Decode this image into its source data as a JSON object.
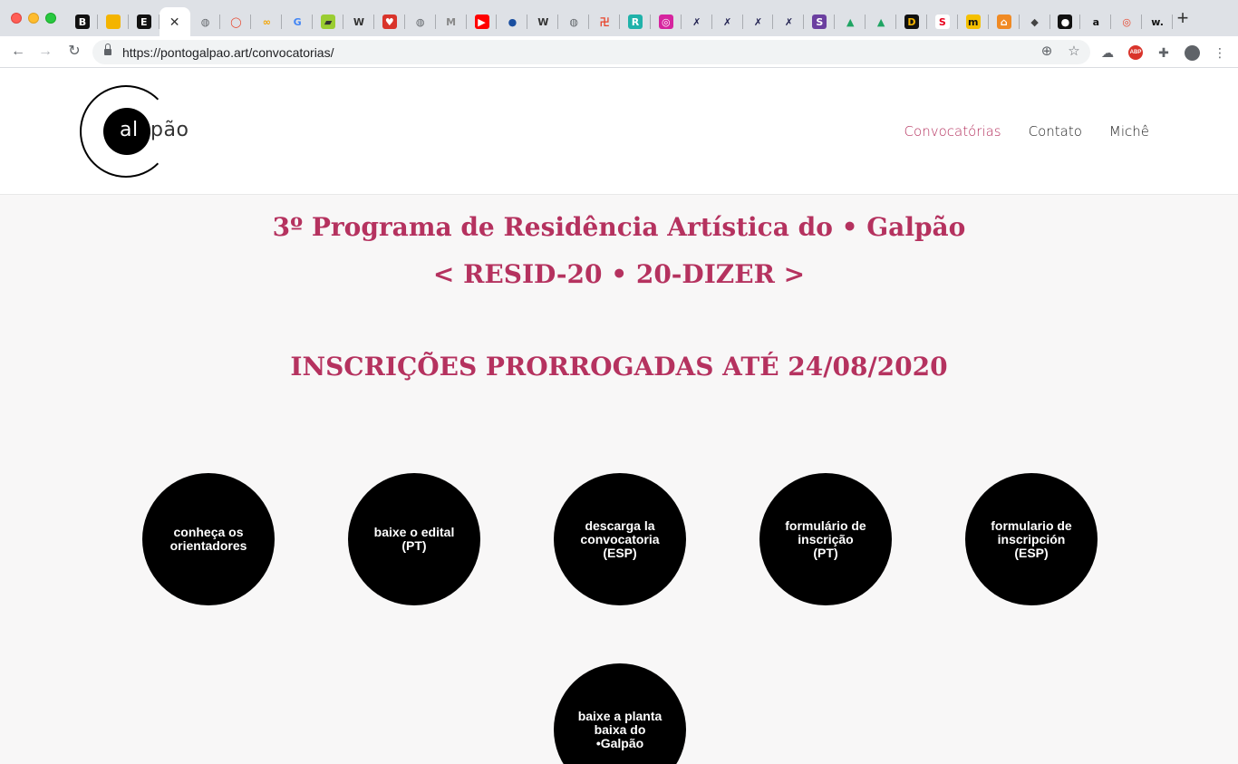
{
  "browser": {
    "tabs": [
      {
        "icon": "B",
        "bg": "#111111",
        "fg": "#ffffff"
      },
      {
        "icon": "",
        "bg": "#f4b400",
        "fg": "#ffffff"
      },
      {
        "icon": "E",
        "bg": "#111111",
        "fg": "#ffffff"
      },
      {
        "icon": "✕",
        "bg": "transparent",
        "fg": "#333333",
        "active": true
      },
      {
        "icon": "◍",
        "bg": "transparent",
        "fg": "#5f6368"
      },
      {
        "icon": "◯",
        "bg": "transparent",
        "fg": "#e8432a"
      },
      {
        "icon": "∞",
        "bg": "transparent",
        "fg": "#f4a400"
      },
      {
        "icon": "G",
        "bg": "transparent",
        "fg": "#4285f4"
      },
      {
        "icon": "▰",
        "bg": "#9acd32",
        "fg": "#333333"
      },
      {
        "icon": "W",
        "bg": "transparent",
        "fg": "#333333"
      },
      {
        "icon": "♥",
        "bg": "#d9342b",
        "fg": "#ffffff"
      },
      {
        "icon": "◍",
        "bg": "transparent",
        "fg": "#5f6368"
      },
      {
        "icon": "M",
        "bg": "transparent",
        "fg": "#888888"
      },
      {
        "icon": "▶",
        "bg": "#ff0000",
        "fg": "#ffffff"
      },
      {
        "icon": "●",
        "bg": "transparent",
        "fg": "#1a4fa0"
      },
      {
        "icon": "W",
        "bg": "transparent",
        "fg": "#333333"
      },
      {
        "icon": "◍",
        "bg": "transparent",
        "fg": "#5f6368"
      },
      {
        "icon": "卍",
        "bg": "transparent",
        "fg": "#e8432a"
      },
      {
        "icon": "R",
        "bg": "#20b2aa",
        "fg": "#ffffff"
      },
      {
        "icon": "◎",
        "bg": "#d6249f",
        "fg": "#ffffff"
      },
      {
        "icon": "✗",
        "bg": "transparent",
        "fg": "#1f1f4f"
      },
      {
        "icon": "✗",
        "bg": "transparent",
        "fg": "#1f1f4f"
      },
      {
        "icon": "✗",
        "bg": "transparent",
        "fg": "#1f1f4f"
      },
      {
        "icon": "✗",
        "bg": "transparent",
        "fg": "#1f1f4f"
      },
      {
        "icon": "S",
        "bg": "#6b3fa0",
        "fg": "#ffffff"
      },
      {
        "icon": "▲",
        "bg": "transparent",
        "fg": "#1fa463"
      },
      {
        "icon": "▲",
        "bg": "transparent",
        "fg": "#1fa463"
      },
      {
        "icon": "D",
        "bg": "#111111",
        "fg": "#f4b400"
      },
      {
        "icon": "S",
        "bg": "#ffffff",
        "fg": "#e8001c"
      },
      {
        "icon": "m",
        "bg": "#f5c000",
        "fg": "#111111"
      },
      {
        "icon": "⌂",
        "bg": "#f08a24",
        "fg": "#ffffff"
      },
      {
        "icon": "◆",
        "bg": "transparent",
        "fg": "#444444"
      },
      {
        "icon": "●",
        "bg": "#111111",
        "fg": "#ffffff"
      },
      {
        "icon": "a",
        "bg": "transparent",
        "fg": "#111111"
      },
      {
        "icon": "◎",
        "bg": "transparent",
        "fg": "#e8432a"
      },
      {
        "icon": "w.",
        "bg": "transparent",
        "fg": "#111111"
      }
    ],
    "url": "https://pontogalpao.art/convocatorias/"
  },
  "site": {
    "logo_text_inner": "al",
    "logo_text_outer": "pão",
    "nav": [
      {
        "label": "Convocatórias",
        "current": true
      },
      {
        "label": "Contato",
        "current": false
      },
      {
        "label": "Michê",
        "current": false
      }
    ]
  },
  "main": {
    "title_line1": "3º Programa de Residência Artística do • Galpão",
    "title_line2": "< RESID-20 • 20-DIZER >",
    "deadline": "INSCRIÇÕES PRORROGADAS ATÉ 24/08/2020",
    "buttons": [
      {
        "label": "conheça os\norientadores"
      },
      {
        "label": "baixe o edital\n(PT)"
      },
      {
        "label": "descarga la\nconvocatoria\n(ESP)"
      },
      {
        "label": "formulário de\ninscrição\n(PT)"
      },
      {
        "label": "formulario de\ninscripción\n(ESP)"
      },
      {
        "label": "baixe a planta\nbaixa do •Galpão"
      }
    ]
  },
  "colors": {
    "accent": "#b5325f",
    "page_bg": "#f8f7f7",
    "button_bg": "#000000"
  }
}
